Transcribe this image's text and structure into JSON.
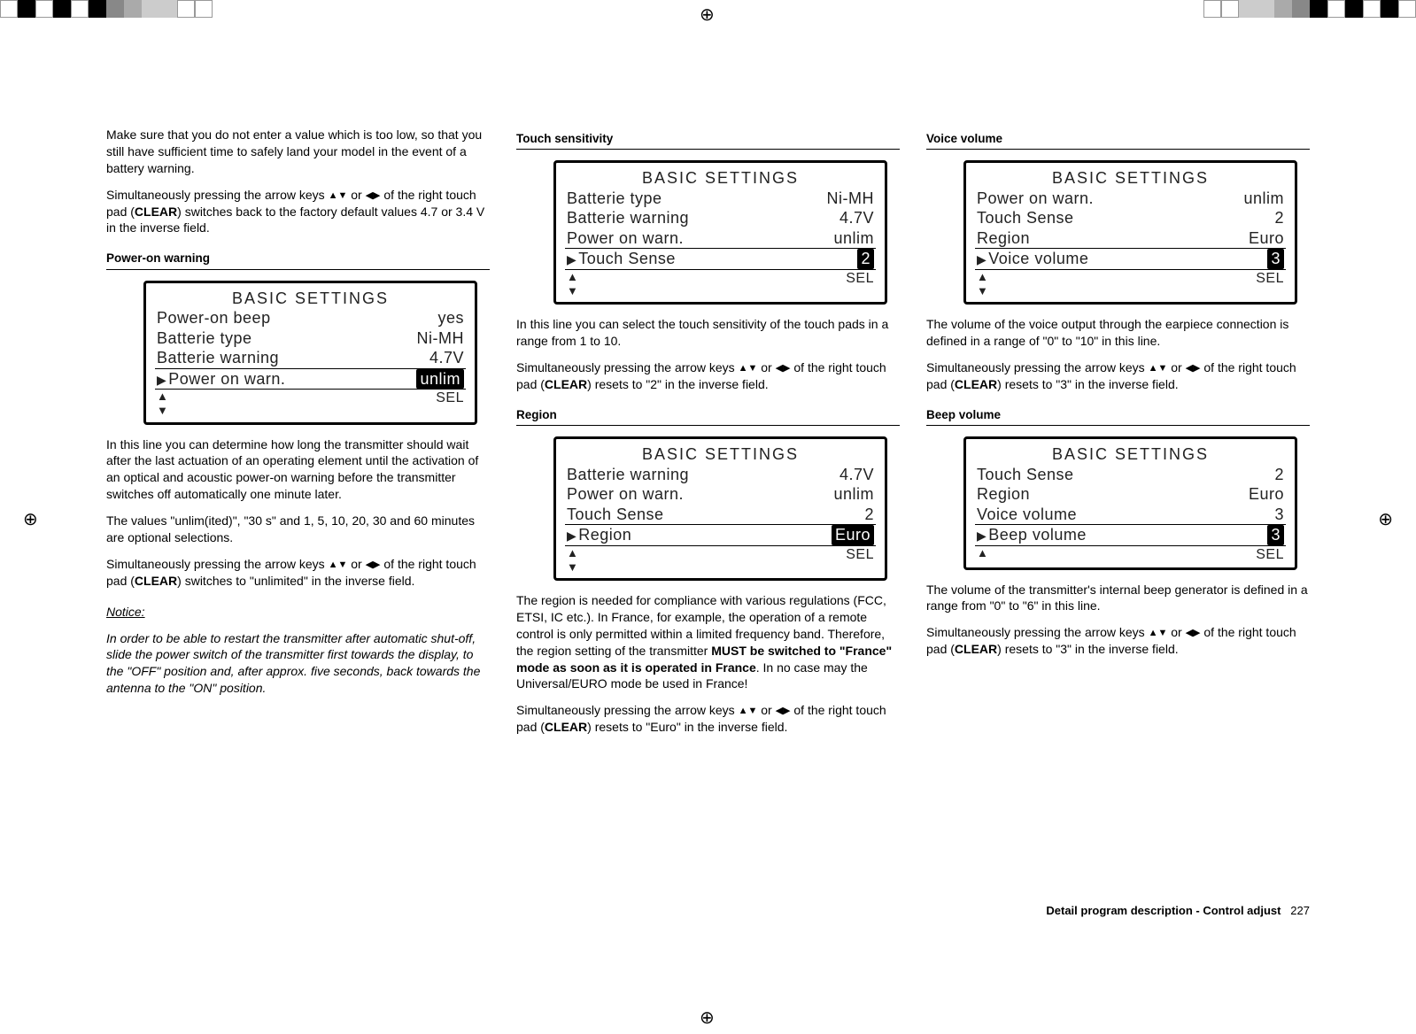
{
  "col1": {
    "intro1": "Make sure that you do not enter a value which is too low, so that you still have sufficient time to safely land your model in the event of a battery warning.",
    "intro2a": "Simultaneously pressing the arrow keys ",
    "intro2b": " or ",
    "intro2c": " of the right touch pad (",
    "intro2d": ") switches back to the factory default values 4.7 or 3.4 V in the inverse field.",
    "clear": "CLEAR",
    "heading": "Power-on warning",
    "lcd": {
      "title": "BASIC  SETTINGS",
      "r1l": "Power-on beep",
      "r1v": "yes",
      "r2l": "Batterie type",
      "r2v": "Ni-MH",
      "r3l": "Batterie warning",
      "r3v": "4.7V",
      "r4l": "Power on warn.",
      "r4v": "unlim",
      "ftr": "SEL"
    },
    "after1": "In this line you can determine how long the transmitter should wait after the last actuation of an operating element until the activation of an optical and acoustic power-on warning before the transmitter switches off automatically one minute later.",
    "after2": "The values \"unlim(ited)\", \"30 s\" and 1, 5, 10, 20, 30 and 60 minutes are optional selections.",
    "after3a": "Simultaneously pressing the arrow keys ",
    "after3b": " or ",
    "after3c": " of the right touch pad (",
    "after3d": ") switches to \"unlimited\" in the inverse field.",
    "noticeLabel": "Notice:",
    "noticeBody": "In order to be able to restart the transmitter after automatic shut-off, slide the power switch of the transmitter first towards the display, to the \"OFF\" position and, after approx. five seconds, back towards the antenna to the \"ON\" position."
  },
  "col2": {
    "h1": "Touch sensitivity",
    "lcd1": {
      "title": "BASIC  SETTINGS",
      "r1l": "Batterie type",
      "r1v": "Ni-MH",
      "r2l": "Batterie warning",
      "r2v": "4.7V",
      "r3l": "Power on warn.",
      "r3v": "unlim",
      "r4l": "Touch Sense",
      "r4v": "2",
      "ftr": "SEL"
    },
    "p1": "In this line you can select the touch sensitivity of the touch pads in a range from 1 to 10.",
    "p2a": "Simultaneously pressing the arrow keys ",
    "p2b": " or ",
    "p2c": " of the right touch pad (",
    "p2d": ") resets to \"2\" in the inverse field.",
    "clear": "CLEAR",
    "h2": "Region",
    "lcd2": {
      "title": "BASIC  SETTINGS",
      "r1l": "Batterie warning",
      "r1v": "4.7V",
      "r2l": "Power on warn.",
      "r2v": "unlim",
      "r3l": "Touch Sense",
      "r3v": "2",
      "r4l": "Region",
      "r4v": "Euro",
      "ftr": "SEL"
    },
    "p3a": "The region is needed for compliance with various regulations (FCC, ETSI, IC etc.). In France, for example, the operation of a remote control is only permitted within a limited frequency band. Therefore, the region setting of the transmitter ",
    "p3bold": "MUST be switched to \"France\" mode as soon as it is operated in France",
    "p3b": ". In no case may the Universal/EURO mode be used in France!",
    "p4a": "Simultaneously pressing the arrow keys ",
    "p4b": " or ",
    "p4c": " of the right touch pad (",
    "p4d": ") resets to \"Euro\" in the inverse field."
  },
  "col3": {
    "h1": "Voice volume",
    "lcd1": {
      "title": "BASIC  SETTINGS",
      "r1l": "Power on warn.",
      "r1v": "unlim",
      "r2l": "Touch Sense",
      "r2v": "2",
      "r3l": "Region",
      "r3v": "Euro",
      "r4l": "Voice volume",
      "r4v": "3",
      "ftr": "SEL"
    },
    "p1": "The volume of the voice output through the earpiece connection is defined in a range of \"0\" to \"10\" in this line.",
    "p2a": "Simultaneously pressing the arrow keys ",
    "p2b": " or ",
    "p2c": " of the right touch pad (",
    "p2d": ") resets to \"3\" in the inverse field.",
    "clear": "CLEAR",
    "h2": "Beep volume",
    "lcd2": {
      "title": "BASIC  SETTINGS",
      "r1l": "Touch Sense",
      "r1v": "2",
      "r2l": "Region",
      "r2v": "Euro",
      "r3l": "Voice volume",
      "r3v": "3",
      "r4l": "Beep volume",
      "r4v": "3",
      "ftr": "SEL"
    },
    "p3": "The volume of the transmitter's internal beep generator is defined in a range from \"0\" to \"6\" in this line.",
    "p4a": "Simultaneously pressing the arrow keys ",
    "p4b": " or ",
    "p4c": " of the right touch pad (",
    "p4d": ") resets to \"3\" in the inverse field."
  },
  "footer": {
    "text": "Detail program description - Control adjust",
    "page": "227"
  }
}
